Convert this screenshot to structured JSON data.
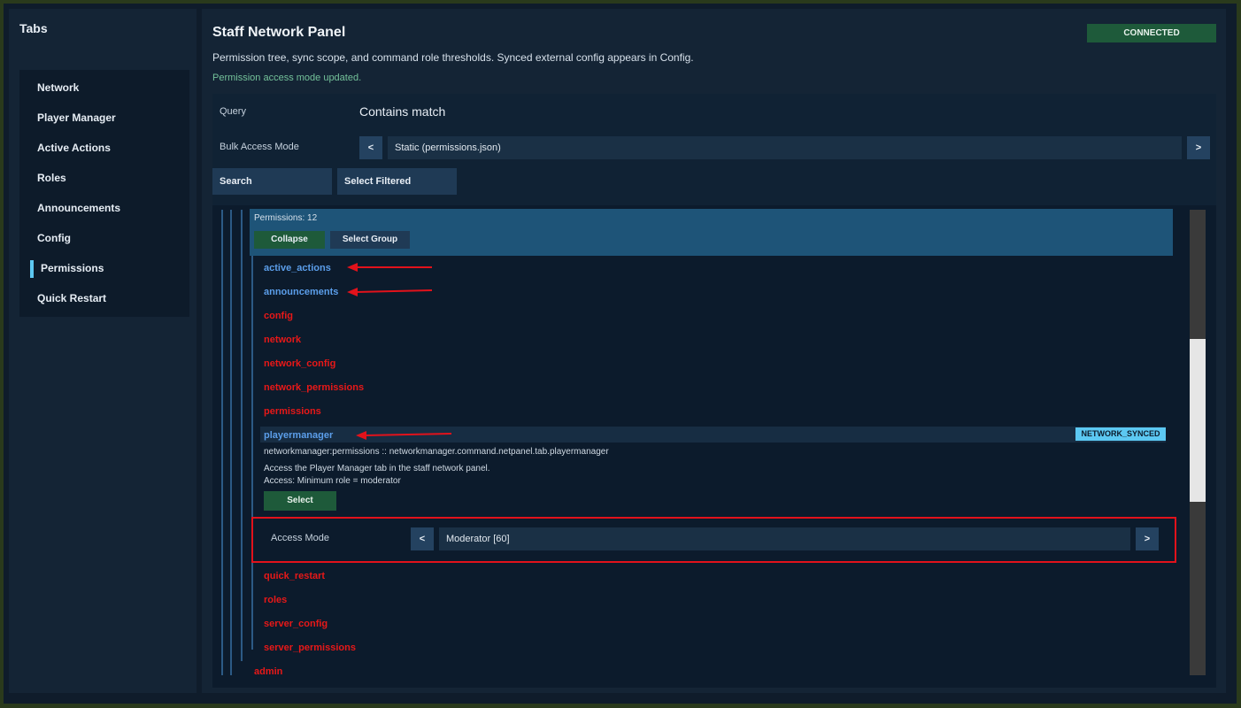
{
  "sidebar": {
    "title": "Tabs",
    "items": [
      {
        "label": "Network"
      },
      {
        "label": "Player Manager"
      },
      {
        "label": "Active Actions"
      },
      {
        "label": "Roles"
      },
      {
        "label": "Announcements"
      },
      {
        "label": "Config"
      },
      {
        "label": "Permissions",
        "active": true
      },
      {
        "label": "Quick Restart"
      }
    ]
  },
  "header": {
    "title": "Staff Network Panel",
    "connection_status": "CONNECTED",
    "subtitle": "Permission tree, sync scope, and command role thresholds. Synced external config appears in Config.",
    "status_message": "Permission access mode updated."
  },
  "controls": {
    "query_label": "Query",
    "query_value": "Contains match",
    "bulk_label": "Bulk Access Mode",
    "prev": "<",
    "next": ">",
    "bulk_value": "Static (permissions.json)",
    "search_button": "Search",
    "select_filtered_button": "Select Filtered"
  },
  "tree": {
    "group_count": "Permissions: 12",
    "collapse_button": "Collapse",
    "select_group_button": "Select Group",
    "items_before": [
      {
        "label": "active_actions",
        "color": "blue"
      },
      {
        "label": "announcements",
        "color": "blue"
      },
      {
        "label": "config",
        "color": "red"
      },
      {
        "label": "network",
        "color": "red"
      },
      {
        "label": "network_config",
        "color": "red"
      },
      {
        "label": "network_permissions",
        "color": "red"
      },
      {
        "label": "permissions",
        "color": "red"
      }
    ],
    "expanded": {
      "label": "playermanager",
      "badge": "NETWORK_SYNCED",
      "node": "networkmanager:permissions :: networkmanager.command.netpanel.tab.playermanager",
      "description": "Access the Player Manager tab in the staff network panel.",
      "access_text": "Access: Minimum role = moderator",
      "select_button": "Select",
      "access_mode_label": "Access Mode",
      "access_mode_value": "Moderator [60]"
    },
    "items_after": [
      {
        "label": "quick_restart",
        "color": "red"
      },
      {
        "label": "roles",
        "color": "red"
      },
      {
        "label": "server_config",
        "color": "red"
      },
      {
        "label": "server_permissions",
        "color": "red"
      }
    ],
    "parent_item": "admin"
  },
  "colors": {
    "accent": "#5cc8f2",
    "connected": "#1e5a3a",
    "item_blue": "#5b9eea",
    "item_red": "#e81818",
    "annotation_red": "#e2121b"
  }
}
